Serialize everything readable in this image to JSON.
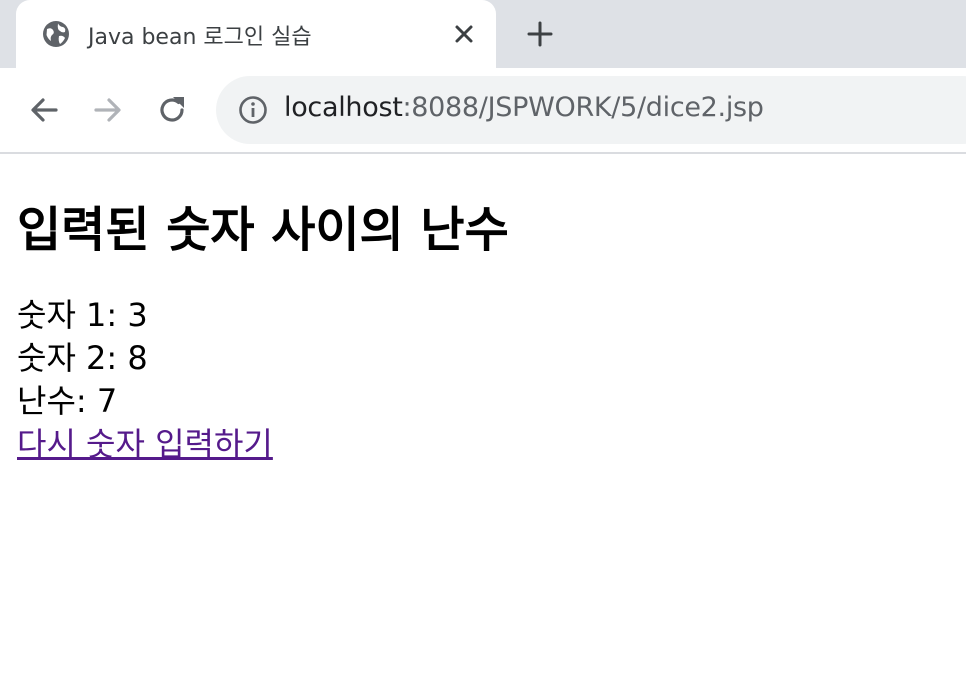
{
  "browser": {
    "tab": {
      "favicon": "globe-icon",
      "title": "Java bean 로그인 실습",
      "close_icon": "close-icon"
    },
    "new_tab_icon": "plus-icon",
    "nav": {
      "back_icon": "arrow-left-icon",
      "forward_icon": "arrow-right-icon",
      "reload_icon": "reload-icon"
    },
    "address": {
      "info_icon": "info-icon",
      "host": "localhost",
      "path": ":8088/JSPWORK/5/dice2.jsp"
    }
  },
  "page": {
    "heading": "입력된 숫자 사이의 난수",
    "lines": [
      "숫자 1: 3",
      "숫자 2: 8",
      "난수: 7"
    ],
    "link": "다시 숫자 입력하기"
  },
  "colors": {
    "tabstrip": "#dee1e6",
    "omnibox": "#f1f3f4",
    "visited_link": "#551a8b"
  }
}
